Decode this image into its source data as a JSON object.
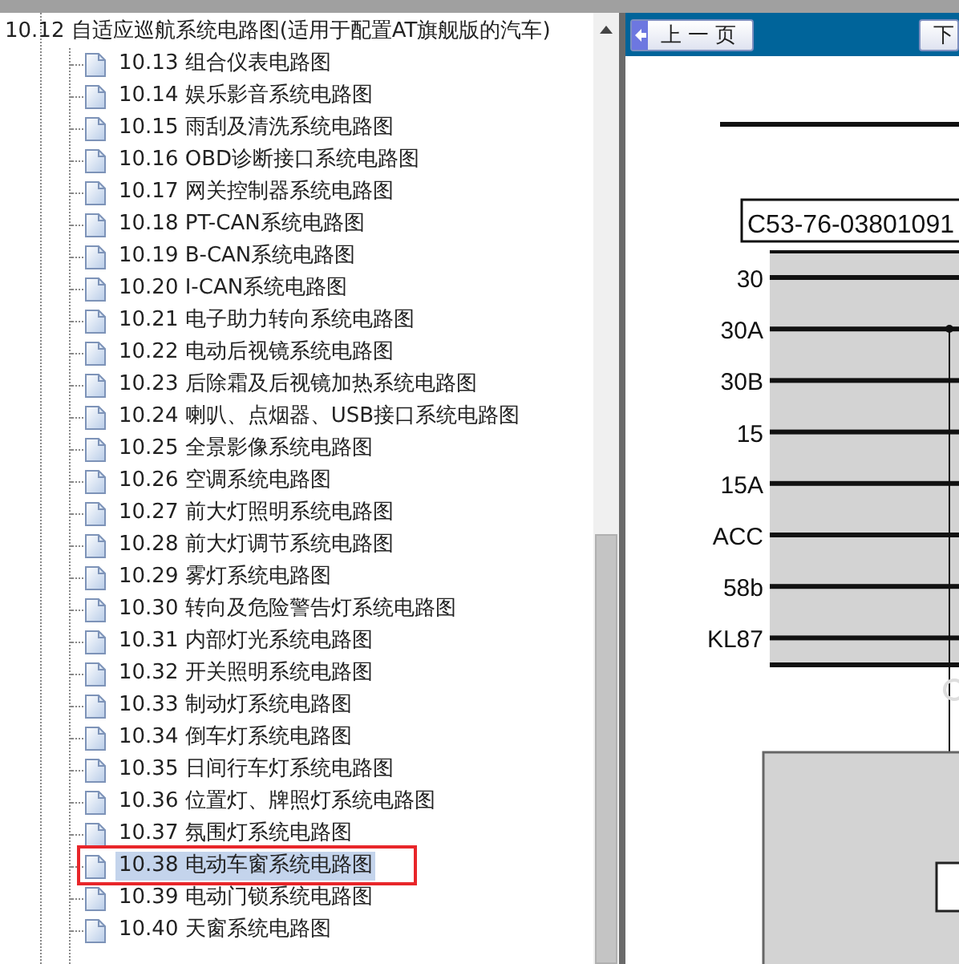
{
  "tree": {
    "items": [
      {
        "label": "10.12 自适应巡航系统电路图(适用于配置AT旗舰版的汽车)",
        "selected": false,
        "children": [
          {
            "label": "10.13 组合仪表电路图",
            "selected": false,
            "outlined": false
          },
          {
            "label": "10.14 娱乐影音系统电路图",
            "selected": false,
            "outlined": false
          },
          {
            "label": "10.15 雨刮及清洗系统电路图",
            "selected": false,
            "outlined": false
          },
          {
            "label": "10.16 OBD诊断接口系统电路图",
            "selected": false,
            "outlined": false
          },
          {
            "label": "10.17 网关控制器系统电路图",
            "selected": false,
            "outlined": false
          },
          {
            "label": "10.18 PT-CAN系统电路图",
            "selected": false,
            "outlined": false
          },
          {
            "label": "10.19 B-CAN系统电路图",
            "selected": false,
            "outlined": false
          },
          {
            "label": "10.20 I-CAN系统电路图",
            "selected": false,
            "outlined": false
          },
          {
            "label": "10.21 电子助力转向系统电路图",
            "selected": false,
            "outlined": false
          },
          {
            "label": "10.22 电动后视镜系统电路图",
            "selected": false,
            "outlined": false
          },
          {
            "label": "10.23 后除霜及后视镜加热系统电路图",
            "selected": false,
            "outlined": false
          },
          {
            "label": "10.24 喇叭、点烟器、USB接口系统电路图",
            "selected": false,
            "outlined": false
          },
          {
            "label": "10.25 全景影像系统电路图",
            "selected": false,
            "outlined": false
          },
          {
            "label": "10.26 空调系统电路图",
            "selected": false,
            "outlined": false
          },
          {
            "label": "10.27 前大灯照明系统电路图",
            "selected": false,
            "outlined": false
          },
          {
            "label": "10.28 前大灯调节系统电路图",
            "selected": false,
            "outlined": false
          },
          {
            "label": "10.29 雾灯系统电路图",
            "selected": false,
            "outlined": false
          },
          {
            "label": "10.30 转向及危险警告灯系统电路图",
            "selected": false,
            "outlined": false
          },
          {
            "label": "10.31 内部灯光系统电路图",
            "selected": false,
            "outlined": false
          },
          {
            "label": "10.32 开关照明系统电路图",
            "selected": false,
            "outlined": false
          },
          {
            "label": "10.33 制动灯系统电路图",
            "selected": false,
            "outlined": false
          },
          {
            "label": "10.34 倒车灯系统电路图",
            "selected": false,
            "outlined": false
          },
          {
            "label": "10.35 日间行车灯系统电路图",
            "selected": false,
            "outlined": false
          },
          {
            "label": "10.36 位置灯、牌照灯系统电路图",
            "selected": false,
            "outlined": false
          },
          {
            "label": "10.37 氛围灯系统电路图",
            "selected": false,
            "outlined": false
          },
          {
            "label": "10.38 电动车窗系统电路图",
            "selected": true,
            "outlined": true
          },
          {
            "label": "10.39 电动门锁系统电路图",
            "selected": false,
            "outlined": false
          },
          {
            "label": "10.40 天窗系统电路图",
            "selected": false,
            "outlined": false
          }
        ]
      }
    ]
  },
  "viewer": {
    "buttons": [
      {
        "label": "上一页",
        "kind": "prev"
      },
      {
        "label": "下",
        "kind": "next"
      }
    ],
    "diagram": {
      "part_number": "C53-76-03801091",
      "rails": [
        "30",
        "30A",
        "30B",
        "15",
        "15A",
        "ACC",
        "58b",
        "KL87"
      ]
    }
  }
}
